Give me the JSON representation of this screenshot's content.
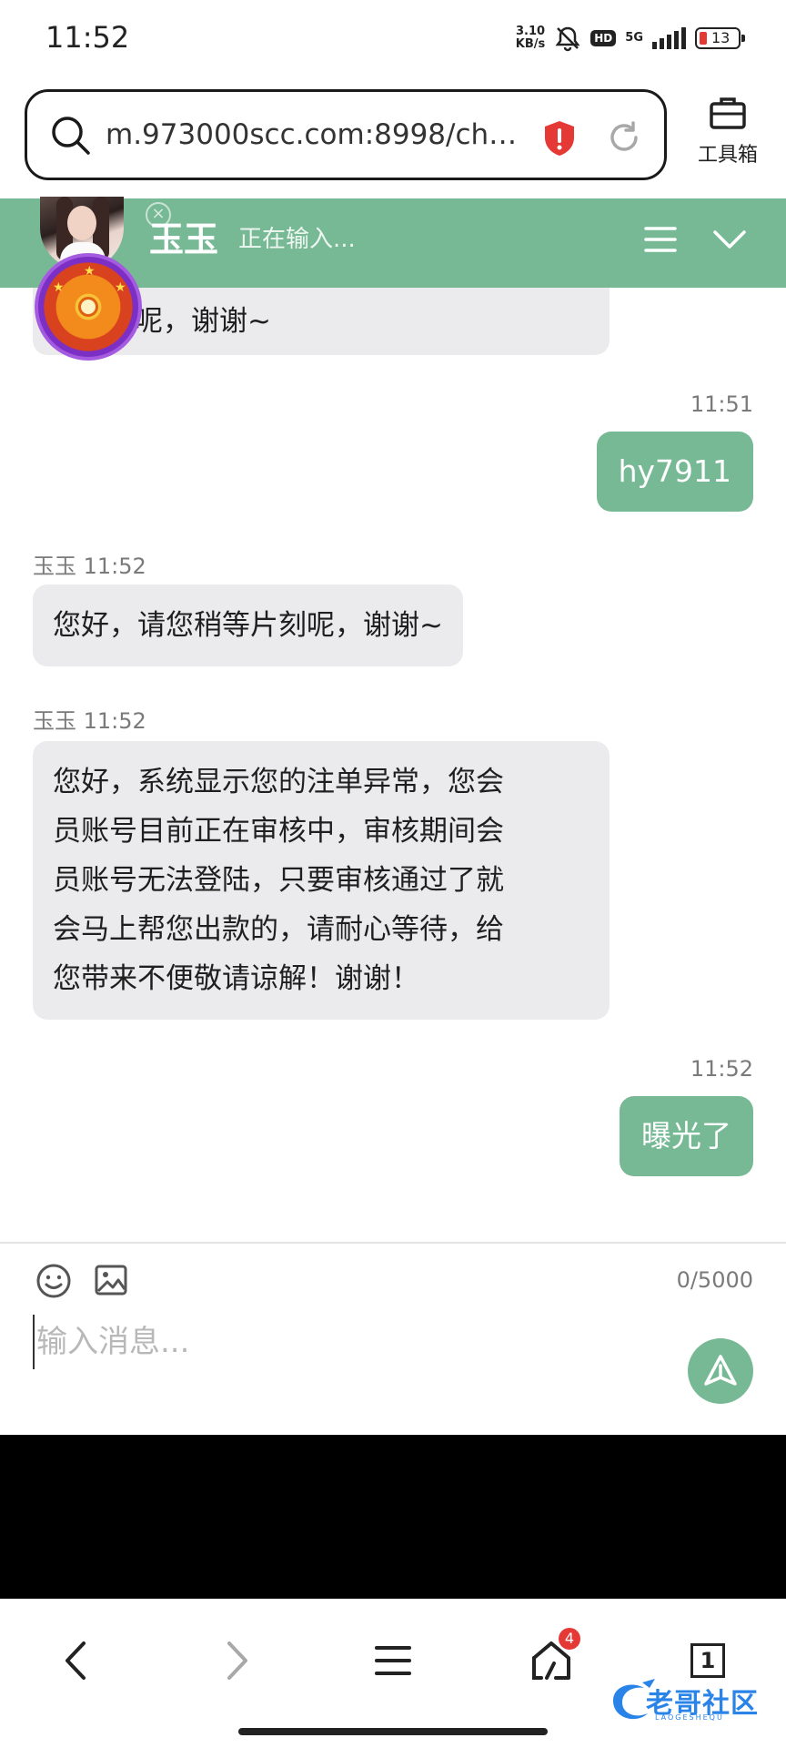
{
  "status_bar": {
    "time": "11:52",
    "net_speed_value": "3.10",
    "net_speed_unit": "KB/s",
    "hd": "HD",
    "network": "5G",
    "battery": "13"
  },
  "browser": {
    "url": "m.973000scc.com:8998/chs...",
    "toolbox_label": "工具箱"
  },
  "chat_header": {
    "agent_name": "玉玉",
    "agent_status": "正在输入..."
  },
  "messages": [
    {
      "direction": "in",
      "meta": "",
      "text": "呢，谢谢~"
    },
    {
      "direction": "out",
      "meta": "11:51",
      "text": "hy7911"
    },
    {
      "direction": "in",
      "meta": "玉玉 11:52",
      "text": "您好，请您稍等片刻呢，谢谢~"
    },
    {
      "direction": "in",
      "meta": "玉玉 11:52",
      "lines": [
        "您好，系统显示您的注单异常，您会",
        "员账号目前正在审核中，审核期间会",
        "员账号无法登陆，只要审核通过了就",
        "会马上帮您出款的，请耐心等待，给",
        "您带来不便敬请谅解！谢谢！"
      ]
    },
    {
      "direction": "out",
      "meta": "11:52",
      "text": "曝光了"
    }
  ],
  "input": {
    "char_count": "0/5000",
    "placeholder": "输入消息..."
  },
  "bottom_nav": {
    "notification_badge": "4",
    "tab_count": "1"
  },
  "watermark": {
    "text": "老哥社区",
    "sub": "LAOGESHEQU"
  },
  "colors": {
    "accent": "#77b995",
    "incoming_bubble": "#ebebee",
    "badge": "#e53935"
  }
}
